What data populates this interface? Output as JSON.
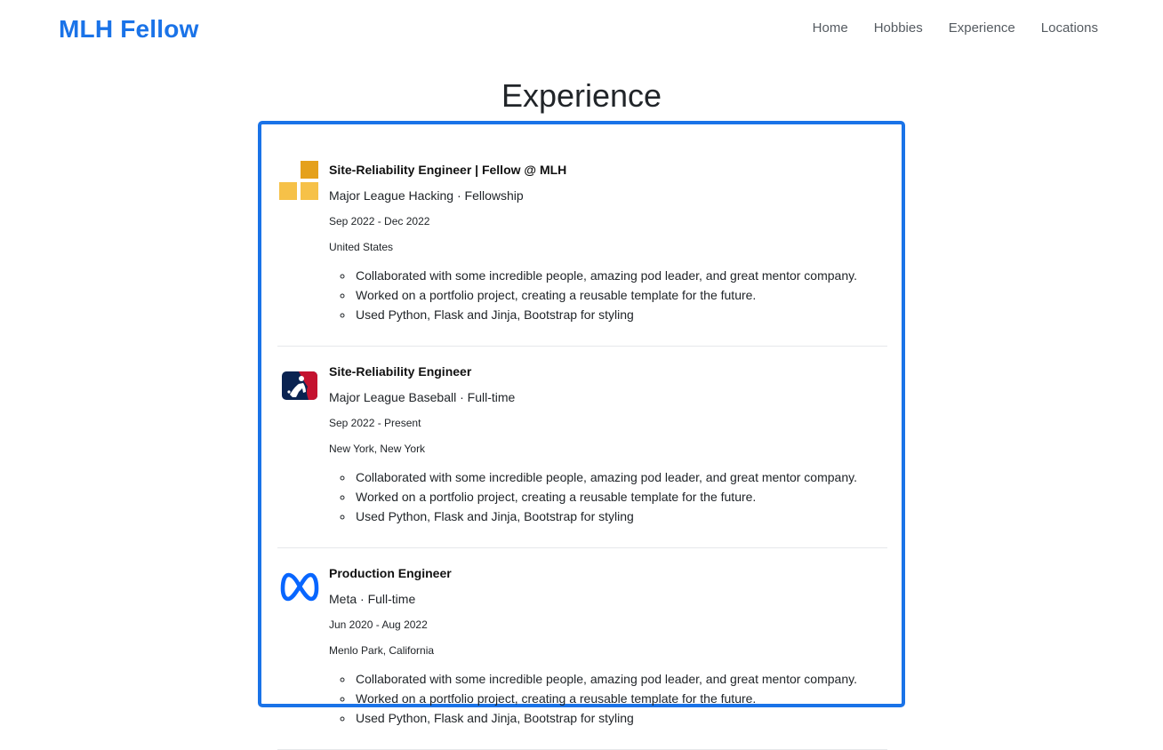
{
  "navbar": {
    "brand": "MLH Fellow",
    "links": [
      "Home",
      "Hobbies",
      "Experience",
      "Locations"
    ]
  },
  "page": {
    "title": "Experience"
  },
  "colors": {
    "accent": "#1a73e8",
    "mlh_logo_dark": "#e5a11c",
    "mlh_logo_light": "#f6c148",
    "mlb_navy": "#0a2351",
    "mlb_red": "#c4122f",
    "meta_blue": "#0866ff"
  },
  "experiences": [
    {
      "logo": "mlh-logo-icon",
      "role": "Site-Reliability Engineer | Fellow @ MLH",
      "company": "Major League Hacking · Fellowship",
      "dates": "Sep 2022 - Dec 2022",
      "location": "United States",
      "bullets": [
        "Collaborated with some incredible people, amazing pod leader, and great mentor company.",
        "Worked on a portfolio project, creating a reusable template for the future.",
        "Used Python, Flask and Jinja, Bootstrap for styling"
      ]
    },
    {
      "logo": "mlb-logo-icon",
      "role": "Site-Reliability Engineer",
      "company": "Major League Baseball · Full-time",
      "dates": "Sep 2022 - Present",
      "location": "New York, New York",
      "bullets": [
        "Collaborated with some incredible people, amazing pod leader, and great mentor company.",
        "Worked on a portfolio project, creating a reusable template for the future.",
        "Used Python, Flask and Jinja, Bootstrap for styling"
      ]
    },
    {
      "logo": "meta-logo-icon",
      "role": "Production Engineer",
      "company": "Meta · Full-time",
      "dates": "Jun 2020 - Aug 2022",
      "location": "Menlo Park, California",
      "bullets": [
        "Collaborated with some incredible people, amazing pod leader, and great mentor company.",
        "Worked on a portfolio project, creating a reusable template for the future.",
        "Used Python, Flask and Jinja, Bootstrap for styling"
      ]
    }
  ]
}
